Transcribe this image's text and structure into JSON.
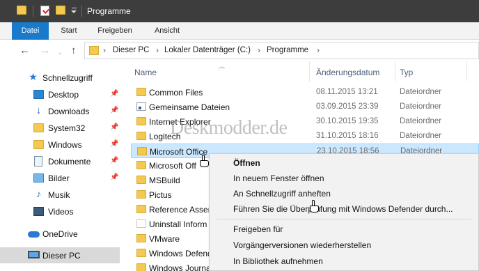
{
  "window": {
    "title": "Programme"
  },
  "ribbon": {
    "tabs": [
      "Datei",
      "Start",
      "Freigeben",
      "Ansicht"
    ]
  },
  "address": {
    "back_icon": "arrow-left-icon",
    "forward_icon": "arrow-right-icon",
    "up_icon": "arrow-up-icon",
    "crumbs": [
      "Dieser PC",
      "Lokaler Datenträger (C:)",
      "Programme"
    ]
  },
  "nav": {
    "items": [
      {
        "label": "Schnellzugriff",
        "icon": "star-icon"
      },
      {
        "label": "Desktop",
        "icon": "desktop-icon",
        "pinned": true
      },
      {
        "label": "Downloads",
        "icon": "download-icon",
        "pinned": true
      },
      {
        "label": "System32",
        "icon": "folder-icon",
        "pinned": true
      },
      {
        "label": "Windows",
        "icon": "folder-icon",
        "pinned": true
      },
      {
        "label": "Dokumente",
        "icon": "documents-icon",
        "pinned": true
      },
      {
        "label": "Bilder",
        "icon": "pictures-icon",
        "pinned": true
      },
      {
        "label": "Musik",
        "icon": "music-icon"
      },
      {
        "label": "Videos",
        "icon": "videos-icon"
      },
      {
        "label": "OneDrive",
        "icon": "cloud-icon"
      },
      {
        "label": "Dieser PC",
        "icon": "computer-icon",
        "selected": true
      }
    ]
  },
  "list": {
    "headers": {
      "name": "Name",
      "date": "Änderungsdatum",
      "type": "Typ"
    },
    "rows": [
      {
        "name": "Common Files",
        "date": "08.11.2015 13:21",
        "type": "Dateiordner"
      },
      {
        "name": "Gemeinsame Dateien",
        "date": "03.09.2015 23:39",
        "type": "Dateiordner"
      },
      {
        "name": "Internet Explorer",
        "date": "30.10.2015 19:35",
        "type": "Dateiordner"
      },
      {
        "name": "Logitech",
        "date": "31.10.2015 18:16",
        "type": "Dateiordner"
      },
      {
        "name": "Microsoft Office",
        "date": "23.10.2015 18:56",
        "type": "Dateiordner",
        "selected": true
      },
      {
        "name": "Microsoft Off",
        "date": "",
        "type": ""
      },
      {
        "name": "MSBuild",
        "date": "",
        "type": ""
      },
      {
        "name": "Pictus",
        "date": "",
        "type": ""
      },
      {
        "name": "Reference Assem",
        "date": "",
        "type": ""
      },
      {
        "name": "Uninstall Inform",
        "date": "",
        "type": ""
      },
      {
        "name": "VMware",
        "date": "",
        "type": ""
      },
      {
        "name": "Windows Defend",
        "date": "",
        "type": ""
      },
      {
        "name": "Windows Journa",
        "date": "",
        "type": ""
      }
    ]
  },
  "watermark": "Deskmodder.de",
  "context_menu": {
    "items": [
      "Öffnen",
      "In neuem Fenster öffnen",
      "An Schnellzugriff anheften",
      "Führen Sie die Überprüfung mit Windows Defender durch...",
      "Freigeben für",
      "Vorgängerversionen wiederherstellen",
      "In Bibliothek aufnehmen"
    ]
  },
  "colors": {
    "titlebar": "#3d3d3d",
    "file_tab": "#1979ca",
    "selection": "#cce8ff",
    "folder": "#f3c950"
  }
}
